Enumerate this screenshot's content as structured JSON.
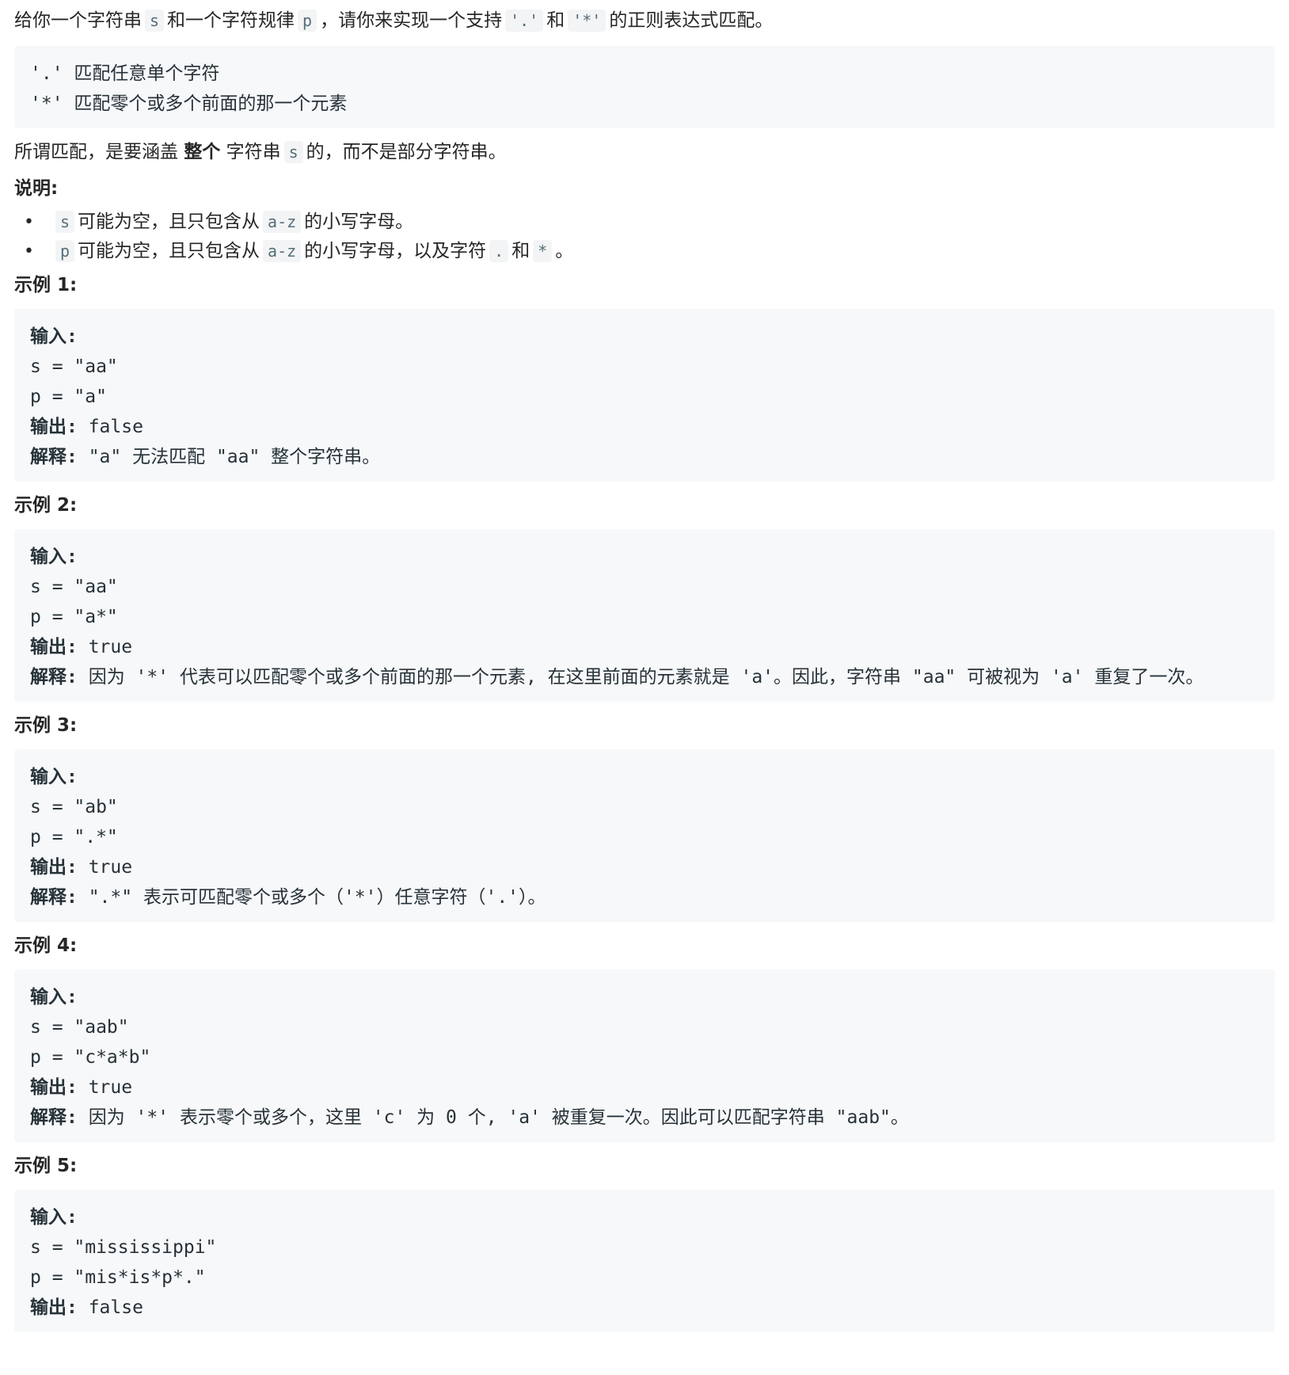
{
  "intro": {
    "t1": "给你一个字符串",
    "c1": "s",
    "t2": "和一个字符规律",
    "c2": "p",
    "t3": "，请你来实现一个支持",
    "c3": "'.'",
    "t4": "和",
    "c4": "'*'",
    "t5": "的正则表达式匹配。"
  },
  "rules": [
    "'.' 匹配任意单个字符",
    "'*' 匹配零个或多个前面的那一个元素"
  ],
  "match_note": {
    "t1": "所谓匹配，是要涵盖",
    "bold": "整个",
    "t2": "字符串",
    "c1": "s",
    "t3": "的，而不是部分字符串。"
  },
  "notes_heading": "说明:",
  "notes": [
    {
      "c1": "s",
      "t1": "可能为空，且只包含从",
      "c2": "a-z",
      "t2": "的小写字母。"
    },
    {
      "c1": "p",
      "t1": "可能为空，且只包含从",
      "c2": "a-z",
      "t2": "的小写字母，以及字符",
      "c3": ".",
      "t3": "和",
      "c4": "*",
      "t4": "。"
    }
  ],
  "bullet": "•",
  "examples": [
    {
      "heading": "示例 1:",
      "input_label": "输入:",
      "s_line": "s = \"aa\"",
      "p_line": "p = \"a\"",
      "output_label": "输出:",
      "output_value": " false",
      "explain_label": "解释:",
      "explain_text": " \"a\" 无法匹配 \"aa\" 整个字符串。"
    },
    {
      "heading": "示例 2:",
      "input_label": "输入:",
      "s_line": "s = \"aa\"",
      "p_line": "p = \"a*\"",
      "output_label": "输出:",
      "output_value": " true",
      "explain_label": "解释:",
      "explain_text": " 因为 '*' 代表可以匹配零个或多个前面的那一个元素, 在这里前面的元素就是 'a'。因此，字符串 \"aa\" 可被视为 'a' 重复了一次。"
    },
    {
      "heading": "示例 3:",
      "input_label": "输入:",
      "s_line": "s = \"ab\"",
      "p_line": "p = \".*\"",
      "output_label": "输出:",
      "output_value": " true",
      "explain_label": "解释:",
      "explain_text": " \".*\" 表示可匹配零个或多个（'*'）任意字符（'.'）。"
    },
    {
      "heading": "示例 4:",
      "input_label": "输入:",
      "s_line": "s = \"aab\"",
      "p_line": "p = \"c*a*b\"",
      "output_label": "输出:",
      "output_value": " true",
      "explain_label": "解释:",
      "explain_text": " 因为 '*' 表示零个或多个，这里 'c' 为 0 个, 'a' 被重复一次。因此可以匹配字符串 \"aab\"。"
    },
    {
      "heading": "示例 5:",
      "input_label": "输入:",
      "s_line": "s = \"mississippi\"",
      "p_line": "p = \"mis*is*p*.\"",
      "output_label": "输出:",
      "output_value": " false"
    }
  ]
}
